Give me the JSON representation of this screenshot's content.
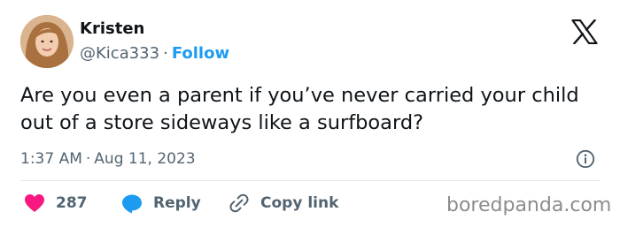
{
  "author": {
    "name": "Kristen",
    "handle": "@Kica333",
    "separator": "·",
    "follow_label": "Follow"
  },
  "tweet": {
    "text": "Are you even a parent if you’ve never carried your child out of a store sideways like a surfboard?",
    "time": "1:37 AM",
    "separator": "·",
    "date": "Aug 11, 2023"
  },
  "actions": {
    "like_count": "287",
    "reply_label": "Reply",
    "copy_label": "Copy link"
  },
  "watermark": "boredpanda.com",
  "icons": {
    "platform": "x-logo-icon",
    "info": "info-icon",
    "like": "heart-icon",
    "reply": "speech-bubble-icon",
    "copy": "link-icon"
  },
  "colors": {
    "follow": "#1d9bf0",
    "heart": "#f91880",
    "reply": "#1d9bf0",
    "muted": "#536471",
    "text": "#0f1419",
    "watermark": "#8c8c8c"
  }
}
